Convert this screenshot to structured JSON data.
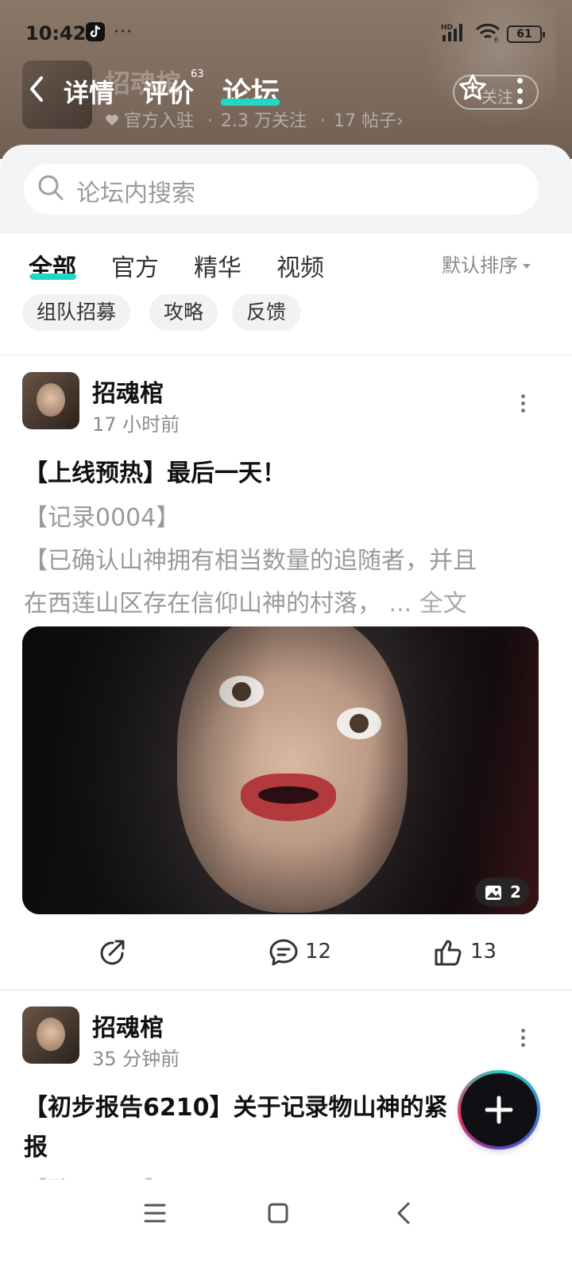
{
  "status_bar": {
    "time": "10:42",
    "more": "···",
    "signal_label": "HD",
    "wifi_label": "6",
    "battery": "61"
  },
  "header": {
    "bg_title": "招魂棺",
    "bg_sub_official": "官方入驻",
    "bg_sub_followers": "2.3 万关注",
    "bg_sub_posts": "17 帖子",
    "bg_sub_sep": "·",
    "bg_sub_chevron": "›",
    "tabs": [
      {
        "label": "详情"
      },
      {
        "label": "评价",
        "count": "63"
      },
      {
        "label": "论坛",
        "active": true
      }
    ],
    "follow_label": "关注"
  },
  "search": {
    "placeholder": "论坛内搜索"
  },
  "filters": {
    "tabs": [
      "全部",
      "官方",
      "精华",
      "视频"
    ],
    "active_tab": "全部",
    "sort_label": "默认排序",
    "chips": [
      "组队招募",
      "攻略",
      "反馈"
    ]
  },
  "posts": [
    {
      "author": "招魂棺",
      "time": "17 小时前",
      "title": "【上线预热】最后一天！",
      "lines": [
        "【记录0004】",
        "【已确认山神拥有相当数量的追随者，并且",
        "在西莲山区存在信仰山神的村落，"
      ],
      "read_more": "... 全文",
      "image_count": "2",
      "comments": "12",
      "likes": "13"
    },
    {
      "author": "招魂棺",
      "time": "35 分钟前",
      "title_line1": "【初步报告6210】关于记录物山神的紧",
      "title_line2": "报",
      "cut_text": "【致D-D-D】"
    }
  ],
  "colors": {
    "accent": "#23d6c2",
    "header_bg": "#7e6b5d"
  },
  "icons": {
    "fab": "plus-icon",
    "share": "share-icon",
    "comment": "comment-icon",
    "like": "thumbs-up-icon"
  }
}
